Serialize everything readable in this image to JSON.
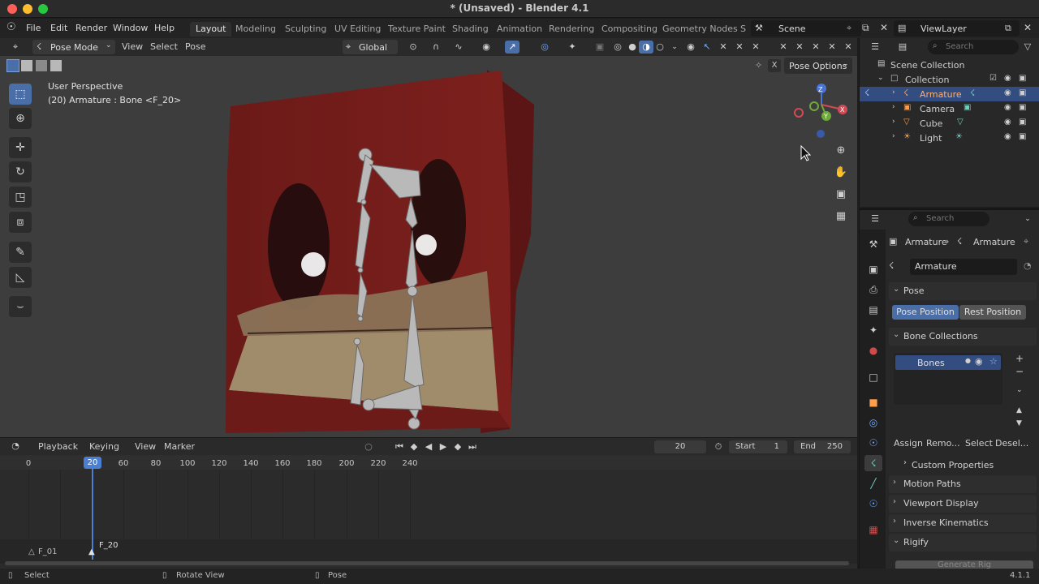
{
  "window": {
    "title": "* (Unsaved) - Blender 4.1",
    "traffic_lights": [
      "#ff5f57",
      "#febc2e",
      "#28c840"
    ]
  },
  "menu": {
    "items": [
      "File",
      "Edit",
      "Render",
      "Window",
      "Help"
    ],
    "workspaces": [
      "Layout",
      "Modeling",
      "Sculpting",
      "UV Editing",
      "Texture Paint",
      "Shading",
      "Animation",
      "Rendering",
      "Compositing",
      "Geometry Nodes",
      "S"
    ],
    "active_workspace": "Layout",
    "scene": "Scene",
    "view_layer": "ViewLayer"
  },
  "viewport": {
    "mode": "Pose Mode",
    "menus": [
      "View",
      "Select",
      "Pose"
    ],
    "orientation": "Global",
    "perspective_label": "User Perspective",
    "object_label": "(20) Armature : Bone <F_20>",
    "pose_options": "Pose Options",
    "x_label": "X",
    "gizmo_labels": {
      "z": "Z",
      "y": "Y",
      "x": "X"
    }
  },
  "timeline": {
    "menus": [
      "Playback",
      "Keying",
      "View",
      "Marker"
    ],
    "current_frame": "20",
    "start_label": "Start",
    "start_value": "1",
    "end_label": "End",
    "end_value": "250",
    "ruler": [
      "0",
      "20",
      "40",
      "60",
      "80",
      "100",
      "120",
      "140",
      "160",
      "180",
      "200",
      "220",
      "240"
    ],
    "marker_f01": "F_01",
    "marker_f20": "F_20"
  },
  "outliner": {
    "search_placeholder": "Search",
    "scene_collection": "Scene Collection",
    "collection": "Collection",
    "objects": [
      "Armature",
      "Camera",
      "Cube",
      "Light"
    ],
    "selected": "Armature"
  },
  "properties": {
    "search_placeholder": "Search",
    "breadcrumb_object": "Armature",
    "breadcrumb_data": "Armature",
    "data_name": "Armature",
    "pose_panel": "Pose",
    "pose_position": "Pose Position",
    "rest_position": "Rest Position",
    "bone_collections_panel": "Bone Collections",
    "bones_item": "Bones",
    "assign": "Assign",
    "remove": "Remo...",
    "select": "Select",
    "deselect": "Desel...",
    "custom_properties": "Custom Properties",
    "motion_paths": "Motion Paths",
    "viewport_display": "Viewport Display",
    "inverse_kinematics": "Inverse Kinematics",
    "rigify": "Rigify",
    "generate_rig": "Generate Rig"
  },
  "status": {
    "select": "Select",
    "rotate_view": "Rotate View",
    "pose": "Pose",
    "version": "4.1.1"
  },
  "colors": {
    "accent": "#4a6ea8",
    "selection": "#334d80",
    "playhead": "#4a7fd1",
    "cube_red": "#7a1f1c"
  }
}
